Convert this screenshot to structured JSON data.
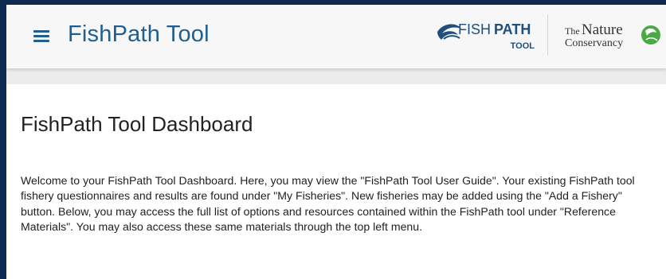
{
  "header": {
    "title": "FishPath Tool",
    "menu_icon": "hamburger-menu-icon",
    "fishpath_logo": {
      "word_fish": "FISH",
      "word_path": "PATH",
      "word_tool": "TOOL",
      "color": "#1f4f7a"
    },
    "partner_logo": {
      "line1_the": "The",
      "line1_nature": "Nature",
      "line2": "Conservancy",
      "leaf_color": "#49a942"
    }
  },
  "main": {
    "page_title": "FishPath Tool Dashboard",
    "welcome_text": "Welcome to your FishPath Tool Dashboard. Here, you may view the \"FishPath Tool User Guide\". Your existing FishPath tool fishery questionnaires and results are found under \"My Fisheries\". New fisheries may be added using the \"Add a Fishery\" button. Below, you may access the full list of options and resources contained within the FishPath tool under \"Reference Materials\". You may also access these same materials through the top left menu."
  },
  "colors": {
    "accent": "#1f5e8f",
    "frame": "#0f2a52",
    "header_bg": "#f7f7f7",
    "text": "#222222"
  }
}
